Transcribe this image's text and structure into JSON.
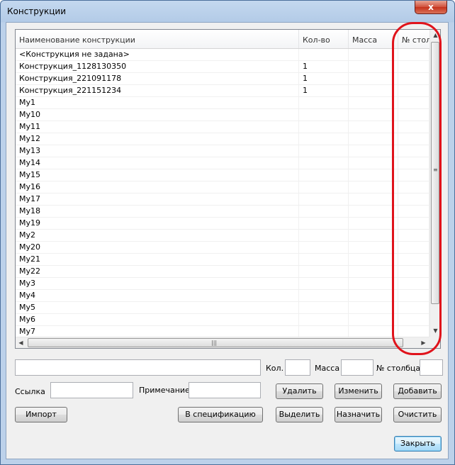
{
  "window": {
    "title": "Конструкции",
    "close_label": "x"
  },
  "columns": [
    {
      "label": "Наименование конструкции"
    },
    {
      "label": "Кол-во"
    },
    {
      "label": "Масса"
    },
    {
      "label": "№ стол"
    }
  ],
  "rows": [
    {
      "name": "<Конструкция не задана>",
      "qty": "",
      "mass": "",
      "col": ""
    },
    {
      "name": "Конструкция_1128130350",
      "qty": "1",
      "mass": "",
      "col": ""
    },
    {
      "name": "Конструкция_221091178",
      "qty": "1",
      "mass": "",
      "col": ""
    },
    {
      "name": "Конструкция_221151234",
      "qty": "1",
      "mass": "",
      "col": ""
    },
    {
      "name": "Mу1",
      "qty": "",
      "mass": "",
      "col": ""
    },
    {
      "name": "Mу10",
      "qty": "",
      "mass": "",
      "col": ""
    },
    {
      "name": "Mу11",
      "qty": "",
      "mass": "",
      "col": ""
    },
    {
      "name": "Mу12",
      "qty": "",
      "mass": "",
      "col": ""
    },
    {
      "name": "Mу13",
      "qty": "",
      "mass": "",
      "col": ""
    },
    {
      "name": "Mу14",
      "qty": "",
      "mass": "",
      "col": ""
    },
    {
      "name": "Mу15",
      "qty": "",
      "mass": "",
      "col": ""
    },
    {
      "name": "Mу16",
      "qty": "",
      "mass": "",
      "col": ""
    },
    {
      "name": "Mу17",
      "qty": "",
      "mass": "",
      "col": ""
    },
    {
      "name": "Mу18",
      "qty": "",
      "mass": "",
      "col": ""
    },
    {
      "name": "Mу19",
      "qty": "",
      "mass": "",
      "col": ""
    },
    {
      "name": "Mу2",
      "qty": "",
      "mass": "",
      "col": ""
    },
    {
      "name": "Mу20",
      "qty": "",
      "mass": "",
      "col": ""
    },
    {
      "name": "Mу21",
      "qty": "",
      "mass": "",
      "col": ""
    },
    {
      "name": "Mу22",
      "qty": "",
      "mass": "",
      "col": ""
    },
    {
      "name": "Mу3",
      "qty": "",
      "mass": "",
      "col": ""
    },
    {
      "name": "Mу4",
      "qty": "",
      "mass": "",
      "col": ""
    },
    {
      "name": "Mу5",
      "qty": "",
      "mass": "",
      "col": ""
    },
    {
      "name": "Mу6",
      "qty": "",
      "mass": "",
      "col": ""
    },
    {
      "name": "Mу7",
      "qty": "",
      "mass": "",
      "col": ""
    }
  ],
  "form": {
    "qty_label": "Кол.",
    "mass_label": "Масса",
    "column_label": "№ столбца",
    "link_label": "Ссылка",
    "note_label": "Примечание",
    "name_value": "",
    "qty_value": "",
    "mass_value": "",
    "column_value": "",
    "link_value": "",
    "note_value": ""
  },
  "buttons": {
    "delete": "Удалить",
    "edit": "Изменить",
    "add": "Добавить",
    "import": "Импорт",
    "to_spec": "В спецификацию",
    "select": "Выделить",
    "assign": "Назначить",
    "clear": "Очистить",
    "close": "Закрыть"
  },
  "colors": {
    "highlight": "#e0131b",
    "title_bar": "#b9d1ea",
    "close_button": "#c7432f"
  }
}
